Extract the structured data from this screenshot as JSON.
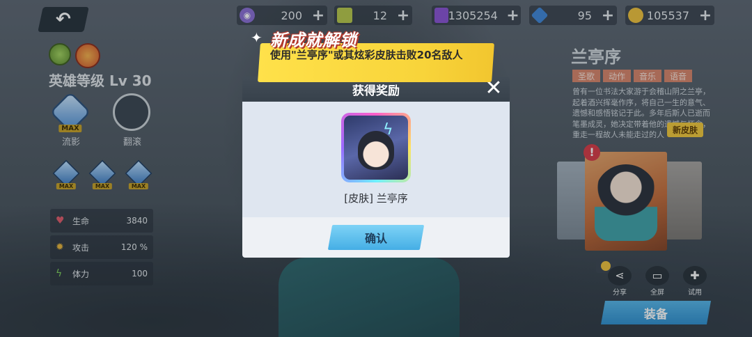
{
  "currencies": [
    {
      "icon": "purple-orb-icon",
      "value": "200",
      "color": "#8b6ed6"
    },
    {
      "icon": "green-ticket-icon",
      "value": "12",
      "color": "#b9c94a"
    },
    {
      "icon": "purple-cube-icon",
      "value": "1305254",
      "color": "#8a52d4"
    },
    {
      "icon": "blue-gem-icon",
      "value": "95",
      "color": "#3f86d8"
    },
    {
      "icon": "gold-coin-icon",
      "value": "105537",
      "color": "#f0c23b"
    }
  ],
  "hero": {
    "level_text": "英雄等级 Lv 30",
    "skills": [
      {
        "label": "流影",
        "badge": "MAX"
      },
      {
        "label": "翻滚"
      }
    ],
    "small_skills": [
      "MAX",
      "MAX",
      "MAX"
    ],
    "stats": [
      {
        "icon": "heart-icon",
        "label": "生命",
        "value": "3840"
      },
      {
        "icon": "attack-icon",
        "label": "攻击",
        "value": "120 %"
      },
      {
        "icon": "stamina-icon",
        "label": "体力",
        "value": "100"
      }
    ]
  },
  "skin_panel": {
    "name": "兰亭序",
    "tags": [
      "圣歌",
      "动作",
      "音乐",
      "语音"
    ],
    "description": "曾有一位书法大家游于会稽山阴之兰亭，起着酒兴挥毫作序，将自己一生的意气、遗憾和感悟铭记于此。多年后斯人已逝而笔墨成灵，她决定带着他的遗憾与怀念，重走一程故人未能走过的人",
    "new_badge": "新皮肤",
    "actions": [
      {
        "icon": "share-icon",
        "label": "分享"
      },
      {
        "icon": "fullscreen-icon",
        "label": "全屏"
      },
      {
        "icon": "gamepad-icon",
        "label": "试用"
      }
    ],
    "equip_label": "装备"
  },
  "achievement": {
    "title": "新成就解锁",
    "text": "使用\"兰亭序\"或其炫彩皮肤击败20名敌人"
  },
  "reward_dialog": {
    "title": "获得奖励",
    "item_label": "[皮肤] 兰亭序",
    "confirm_label": "确认"
  }
}
